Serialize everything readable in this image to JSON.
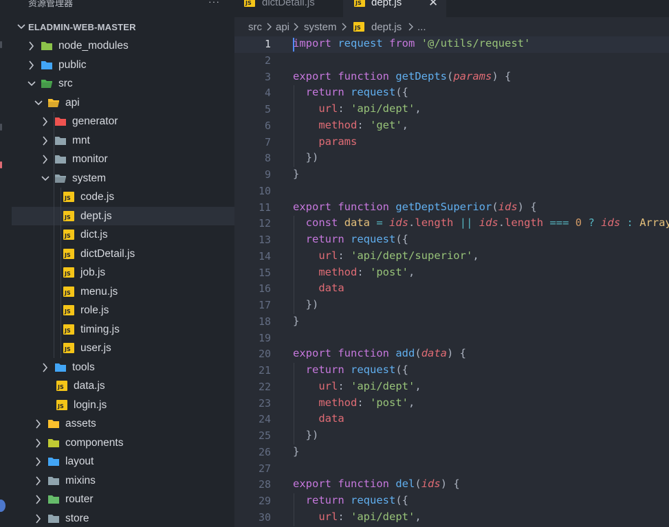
{
  "explorer": {
    "title": "资源管理器",
    "more": "···",
    "root": "ELADMIN-WEB-MASTER",
    "items": [
      {
        "label": "node_modules",
        "depth": 1,
        "expanded": false,
        "icon": "node-folder-icon",
        "color": "#8bc34a"
      },
      {
        "label": "public",
        "depth": 1,
        "expanded": false,
        "icon": "public-folder-icon",
        "color": "#42a5f5"
      },
      {
        "label": "src",
        "depth": 1,
        "expanded": true,
        "icon": "src-folder-icon",
        "color": "#4caf50"
      },
      {
        "label": "api",
        "depth": 2,
        "expanded": true,
        "icon": "api-folder-icon",
        "color": "#fbc02d"
      },
      {
        "label": "generator",
        "depth": 3,
        "expanded": false,
        "icon": "generator-folder-icon",
        "color": "#ef5350"
      },
      {
        "label": "mnt",
        "depth": 3,
        "expanded": false,
        "icon": "folder-icon",
        "color": "#90a4ae"
      },
      {
        "label": "monitor",
        "depth": 3,
        "expanded": false,
        "icon": "folder-icon",
        "color": "#90a4ae"
      },
      {
        "label": "system",
        "depth": 3,
        "expanded": true,
        "icon": "folder-open-icon",
        "color": "#90a4ae"
      },
      {
        "label": "code.js",
        "depth": 4,
        "file": true,
        "icon": "js-file-icon"
      },
      {
        "label": "dept.js",
        "depth": 4,
        "file": true,
        "icon": "js-file-icon",
        "selected": true
      },
      {
        "label": "dict.js",
        "depth": 4,
        "file": true,
        "icon": "js-file-icon"
      },
      {
        "label": "dictDetail.js",
        "depth": 4,
        "file": true,
        "icon": "js-file-icon"
      },
      {
        "label": "job.js",
        "depth": 4,
        "file": true,
        "icon": "js-file-icon"
      },
      {
        "label": "menu.js",
        "depth": 4,
        "file": true,
        "icon": "js-file-icon"
      },
      {
        "label": "role.js",
        "depth": 4,
        "file": true,
        "icon": "js-file-icon"
      },
      {
        "label": "timing.js",
        "depth": 4,
        "file": true,
        "icon": "js-file-icon"
      },
      {
        "label": "user.js",
        "depth": 4,
        "file": true,
        "icon": "js-file-icon"
      },
      {
        "label": "tools",
        "depth": 3,
        "expanded": false,
        "icon": "tools-folder-icon",
        "color": "#42a5f5"
      },
      {
        "label": "data.js",
        "depth": 3,
        "file": true,
        "icon": "js-file-icon"
      },
      {
        "label": "login.js",
        "depth": 3,
        "file": true,
        "icon": "js-file-icon"
      },
      {
        "label": "assets",
        "depth": 2,
        "expanded": false,
        "icon": "assets-folder-icon",
        "color": "#fbc02d"
      },
      {
        "label": "components",
        "depth": 2,
        "expanded": false,
        "icon": "components-folder-icon",
        "color": "#c0ca33"
      },
      {
        "label": "layout",
        "depth": 2,
        "expanded": false,
        "icon": "layout-folder-icon",
        "color": "#42a5f5"
      },
      {
        "label": "mixins",
        "depth": 2,
        "expanded": false,
        "icon": "folder-icon",
        "color": "#90a4ae"
      },
      {
        "label": "router",
        "depth": 2,
        "expanded": false,
        "icon": "router-folder-icon",
        "color": "#66bb6a"
      },
      {
        "label": "store",
        "depth": 2,
        "expanded": false,
        "icon": "folder-icon",
        "color": "#90a4ae"
      }
    ]
  },
  "tabs": [
    {
      "label": "dictDetail.js",
      "active": false,
      "icon": "js-file-icon"
    },
    {
      "label": "dept.js",
      "active": true,
      "icon": "js-file-icon",
      "close": "✕"
    }
  ],
  "breadcrumb": {
    "parts": [
      "src",
      "api",
      "system",
      "dept.js",
      "..."
    ],
    "separator": "›"
  },
  "editor": {
    "current_line": 1,
    "lines": [
      [
        [
          "kw",
          "import"
        ],
        [
          "p",
          " "
        ],
        [
          "fn",
          "request"
        ],
        [
          "p",
          " "
        ],
        [
          "kw",
          "from"
        ],
        [
          "p",
          " "
        ],
        [
          "str",
          "'@/utils/request'"
        ]
      ],
      [],
      [
        [
          "kw",
          "export"
        ],
        [
          "p",
          " "
        ],
        [
          "kw",
          "function"
        ],
        [
          "p",
          " "
        ],
        [
          "fn",
          "getDepts"
        ],
        [
          "p",
          "("
        ],
        [
          "param",
          "params"
        ],
        [
          "p",
          ") {"
        ]
      ],
      [
        [
          "p",
          "  "
        ],
        [
          "kw",
          "return"
        ],
        [
          "p",
          " "
        ],
        [
          "fn",
          "request"
        ],
        [
          "p",
          "({"
        ]
      ],
      [
        [
          "p",
          "    "
        ],
        [
          "prop",
          "url"
        ],
        [
          "p",
          ": "
        ],
        [
          "str",
          "'api/dept'"
        ],
        [
          "p",
          ","
        ]
      ],
      [
        [
          "p",
          "    "
        ],
        [
          "prop",
          "method"
        ],
        [
          "p",
          ": "
        ],
        [
          "str",
          "'get'"
        ],
        [
          "p",
          ","
        ]
      ],
      [
        [
          "p",
          "    "
        ],
        [
          "prop",
          "params"
        ]
      ],
      [
        [
          "p",
          "  })"
        ]
      ],
      [
        [
          "p",
          "}"
        ]
      ],
      [],
      [
        [
          "kw",
          "export"
        ],
        [
          "p",
          " "
        ],
        [
          "kw",
          "function"
        ],
        [
          "p",
          " "
        ],
        [
          "fn",
          "getDeptSuperior"
        ],
        [
          "p",
          "("
        ],
        [
          "param",
          "ids"
        ],
        [
          "p",
          ") {"
        ]
      ],
      [
        [
          "p",
          "  "
        ],
        [
          "kw",
          "const"
        ],
        [
          "p",
          " "
        ],
        [
          "var",
          "data"
        ],
        [
          "p",
          " "
        ],
        [
          "op",
          "="
        ],
        [
          "p",
          " "
        ],
        [
          "param",
          "ids"
        ],
        [
          "p",
          "."
        ],
        [
          "prop",
          "length"
        ],
        [
          "p",
          " "
        ],
        [
          "op",
          "||"
        ],
        [
          "p",
          " "
        ],
        [
          "param",
          "ids"
        ],
        [
          "p",
          "."
        ],
        [
          "prop",
          "length"
        ],
        [
          "p",
          " "
        ],
        [
          "op",
          "==="
        ],
        [
          "p",
          " "
        ],
        [
          "num",
          "0"
        ],
        [
          "p",
          " "
        ],
        [
          "op",
          "?"
        ],
        [
          "p",
          " "
        ],
        [
          "param",
          "ids"
        ],
        [
          "p",
          " "
        ],
        [
          "op",
          ":"
        ],
        [
          "p",
          " "
        ],
        [
          "var",
          "Array"
        ]
      ],
      [
        [
          "p",
          "  "
        ],
        [
          "kw",
          "return"
        ],
        [
          "p",
          " "
        ],
        [
          "fn",
          "request"
        ],
        [
          "p",
          "({"
        ]
      ],
      [
        [
          "p",
          "    "
        ],
        [
          "prop",
          "url"
        ],
        [
          "p",
          ": "
        ],
        [
          "str",
          "'api/dept/superior'"
        ],
        [
          "p",
          ","
        ]
      ],
      [
        [
          "p",
          "    "
        ],
        [
          "prop",
          "method"
        ],
        [
          "p",
          ": "
        ],
        [
          "str",
          "'post'"
        ],
        [
          "p",
          ","
        ]
      ],
      [
        [
          "p",
          "    "
        ],
        [
          "prop",
          "data"
        ]
      ],
      [
        [
          "p",
          "  })"
        ]
      ],
      [
        [
          "p",
          "}"
        ]
      ],
      [],
      [
        [
          "kw",
          "export"
        ],
        [
          "p",
          " "
        ],
        [
          "kw",
          "function"
        ],
        [
          "p",
          " "
        ],
        [
          "fn",
          "add"
        ],
        [
          "p",
          "("
        ],
        [
          "param",
          "data"
        ],
        [
          "p",
          ") {"
        ]
      ],
      [
        [
          "p",
          "  "
        ],
        [
          "kw",
          "return"
        ],
        [
          "p",
          " "
        ],
        [
          "fn",
          "request"
        ],
        [
          "p",
          "({"
        ]
      ],
      [
        [
          "p",
          "    "
        ],
        [
          "prop",
          "url"
        ],
        [
          "p",
          ": "
        ],
        [
          "str",
          "'api/dept'"
        ],
        [
          "p",
          ","
        ]
      ],
      [
        [
          "p",
          "    "
        ],
        [
          "prop",
          "method"
        ],
        [
          "p",
          ": "
        ],
        [
          "str",
          "'post'"
        ],
        [
          "p",
          ","
        ]
      ],
      [
        [
          "p",
          "    "
        ],
        [
          "prop",
          "data"
        ]
      ],
      [
        [
          "p",
          "  })"
        ]
      ],
      [
        [
          "p",
          "}"
        ]
      ],
      [],
      [
        [
          "kw",
          "export"
        ],
        [
          "p",
          " "
        ],
        [
          "kw",
          "function"
        ],
        [
          "p",
          " "
        ],
        [
          "fn",
          "del"
        ],
        [
          "p",
          "("
        ],
        [
          "param",
          "ids"
        ],
        [
          "p",
          ") {"
        ]
      ],
      [
        [
          "p",
          "  "
        ],
        [
          "kw",
          "return"
        ],
        [
          "p",
          " "
        ],
        [
          "fn",
          "request"
        ],
        [
          "p",
          "({"
        ]
      ],
      [
        [
          "p",
          "    "
        ],
        [
          "prop",
          "url"
        ],
        [
          "p",
          ": "
        ],
        [
          "str",
          "'api/dept'"
        ],
        [
          "p",
          ","
        ]
      ]
    ]
  }
}
